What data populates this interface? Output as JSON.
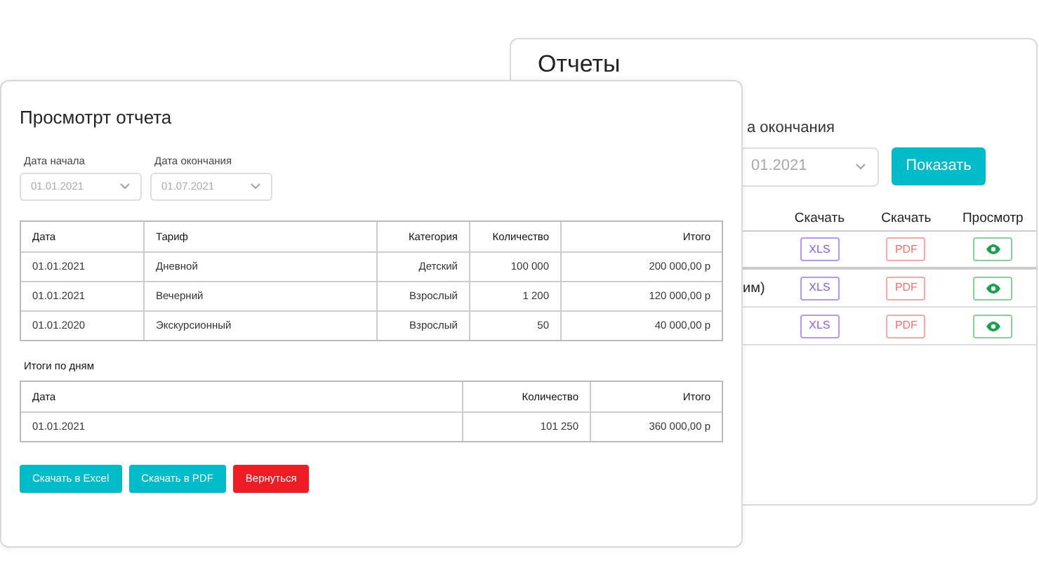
{
  "reports_window": {
    "title": "Отчеты",
    "end_date_label": "а окончания",
    "end_date_value": "01.2021",
    "show_button": "Показать",
    "columns": [
      "Скачать",
      "Скачать",
      "Просмотр"
    ],
    "rows": [
      {
        "name": "",
        "xls": "XLS",
        "pdf": "PDF"
      },
      {
        "name": "им)",
        "xls": "XLS",
        "pdf": "PDF"
      },
      {
        "name": "",
        "xls": "XLS",
        "pdf": "PDF"
      }
    ]
  },
  "report_view": {
    "title": "Просмотрт отчета",
    "filters": [
      {
        "label": "Дата начала",
        "value": "01.01.2021"
      },
      {
        "label": "Дата окончания",
        "value": "01.07.2021"
      }
    ],
    "table": {
      "columns": [
        "Дата",
        "Тариф",
        "Категория",
        "Количество",
        "Итого"
      ],
      "rows": [
        [
          "01.01.2021",
          "Дневной",
          "Детский",
          "100 000",
          "200 000,00 р"
        ],
        [
          "01.01.2021",
          "Вечерний",
          "Взрослый",
          "1 200",
          "120 000,00 р"
        ],
        [
          "01.01.2020",
          "Экскурсионный",
          "Взрослый",
          "50",
          "40 000,00 р"
        ]
      ]
    },
    "daily_title": "Итоги по дням",
    "daily_table": {
      "columns": [
        "Дата",
        "Количество",
        "Итого"
      ],
      "rows": [
        [
          "01.01.2021",
          "101 250",
          "360 000,00 р"
        ]
      ]
    },
    "buttons": [
      {
        "label": "Скачать в Excel",
        "kind": "primary"
      },
      {
        "label": "Скачать в PDF",
        "kind": "primary"
      },
      {
        "label": "Вернуться",
        "kind": "danger"
      }
    ]
  }
}
